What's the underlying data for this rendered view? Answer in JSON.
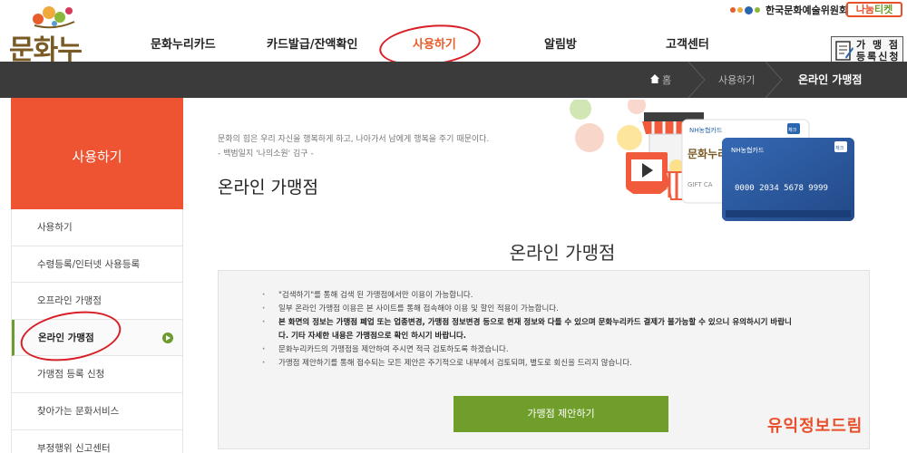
{
  "header": {
    "logo_text": "문화누리",
    "nav": [
      "문화누리카드",
      "카드발급/잔액확인",
      "사용하기",
      "알림방",
      "고객센터"
    ],
    "arts_council": "한국문화예술위원회",
    "nanum_ticket": {
      "part1": "나눔",
      "part2": "티켓"
    },
    "register_line1": "가 맹 점",
    "register_line2": "등록신청"
  },
  "breadcrumb": {
    "home": "홈",
    "level1": "사용하기",
    "current": "온라인 가맹점"
  },
  "sidebar": {
    "title": "사용하기",
    "items": [
      "사용하기",
      "수령등록/인터넷 사용등록",
      "오프라인 가맹점",
      "온라인 가맹점",
      "가맹점 등록 신청",
      "찾아가는 문화서비스",
      "부정행위 신고센터"
    ],
    "active_index": 3
  },
  "main": {
    "quote_line1": "문화의 힘은 우리 자신을 행복하게 하고, 나아가서 남에게 행복을 주기 때문이다.",
    "quote_line2": "- 백범일지 '나의소원' 김구 -",
    "page_title": "온라인 가맹점",
    "section_title": "온라인 가맹점",
    "notices": [
      "\"검색하기\"를 통해 검색 된 가맹점에서만 이용이 가능합니다.",
      "일부 온라인 가맹점 이용은 본 사이트를 통해 접속해야 이용 및 할인 적용이 가능합니다.",
      "본 화면의 정보는 가맹점 폐업 또는 업종변경, 가맹점 정보변경 등으로 현재 정보와 다를 수 있으며 문화누리카드 결제가 불가능할 수 있으니 유의하시기 바랍니",
      "다. 기타 자세한 내용은 가맹점으로 확인 하시기 바랍니다.",
      "문화누리카드의 가맹점을 제안하여 주시면 적극 검토하도록 하겠습니다.",
      "가맹점 제안하기를 통해 접수되는 모든 제안은 주기적으로 내부에서 검토되며, 별도로 회신을 드리지 않습니다."
    ],
    "propose_button": "가맹점 제안하기",
    "card_front": {
      "bank": "NH농협카드",
      "number": "0000 2034 5678 9999",
      "badge": "체크"
    },
    "card_back": {
      "bank": "NH농협카드",
      "label": "GIFT CA",
      "badge": "체크"
    }
  },
  "watermark": "유익정보드림",
  "colors": {
    "accent_orange": "#ee5431",
    "green": "#6f9e2a",
    "dark_bar": "#3b3b3b",
    "highlight_red": "#d81f26"
  }
}
